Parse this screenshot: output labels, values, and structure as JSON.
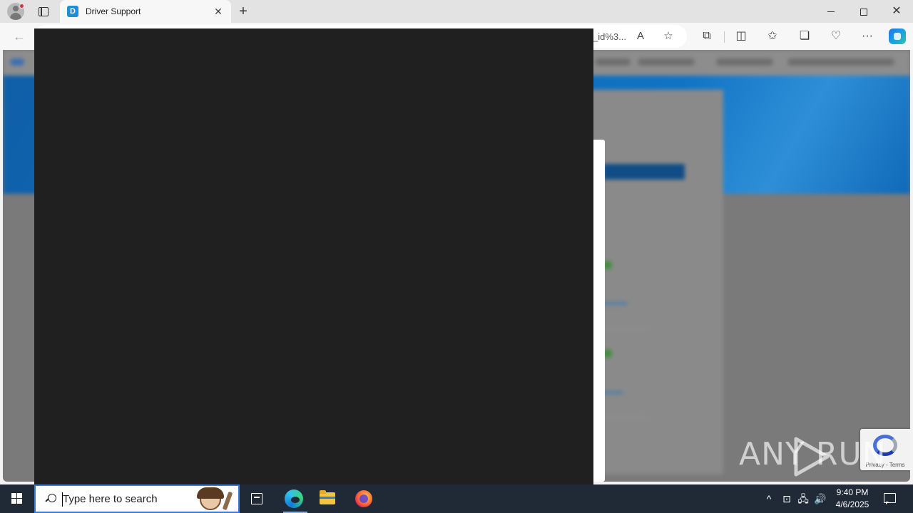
{
  "browser": {
    "tab": {
      "title": "Driver Support",
      "favicon_letter": "D",
      "close_glyph": "✕"
    },
    "new_tab_glyph": "+",
    "window_controls": {
      "close_glyph": "✕"
    },
    "address_bar": {
      "visible_url_fragment": "_id%3..."
    },
    "toolbar_glyphs": {
      "back": "←",
      "read_aloud": "A",
      "favorite": "☆",
      "extensions": "⧉",
      "split_screen": "◫",
      "favorites": "✩",
      "collections": "❏",
      "browser_essentials": "♡",
      "more": "···"
    }
  },
  "page": {
    "recaptcha_text": "Privacy - Terms",
    "watermark_text": "ANY     RUN"
  },
  "taskbar": {
    "search_placeholder": "Type here to search",
    "clock_time": "9:40 PM",
    "clock_date": "4/6/2025",
    "tray_glyphs": {
      "chevron": "^",
      "meet": "⊡",
      "network": "🖧",
      "volume": "🔊"
    }
  },
  "colors": {
    "accent": "#0f6cbd",
    "hero_blue": "#1173c4",
    "taskbar": "#1f2a36",
    "overlay": "#202020"
  }
}
